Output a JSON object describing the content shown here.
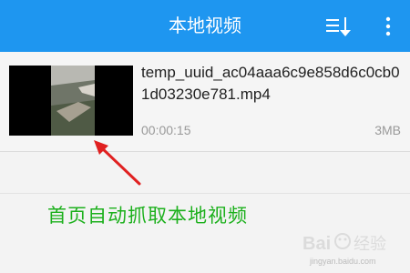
{
  "header": {
    "title": "本地视频",
    "sort_icon": "sort-icon",
    "more_icon": "more-vert-icon",
    "bg_color": "#1e96f0"
  },
  "video_list": [
    {
      "file_name": "temp_uuid_ac04aaa6c9e858d6c0cb01d03230e781.mp4",
      "duration": "00:00:15",
      "size": "3MB"
    }
  ],
  "annotation": {
    "caption": "首页自动抓取本地视频",
    "caption_color": "#1cb01c",
    "arrow_color": "#e02020"
  },
  "watermark": {
    "text": "Bai经验",
    "sub": "jingyan.baidu.com"
  }
}
